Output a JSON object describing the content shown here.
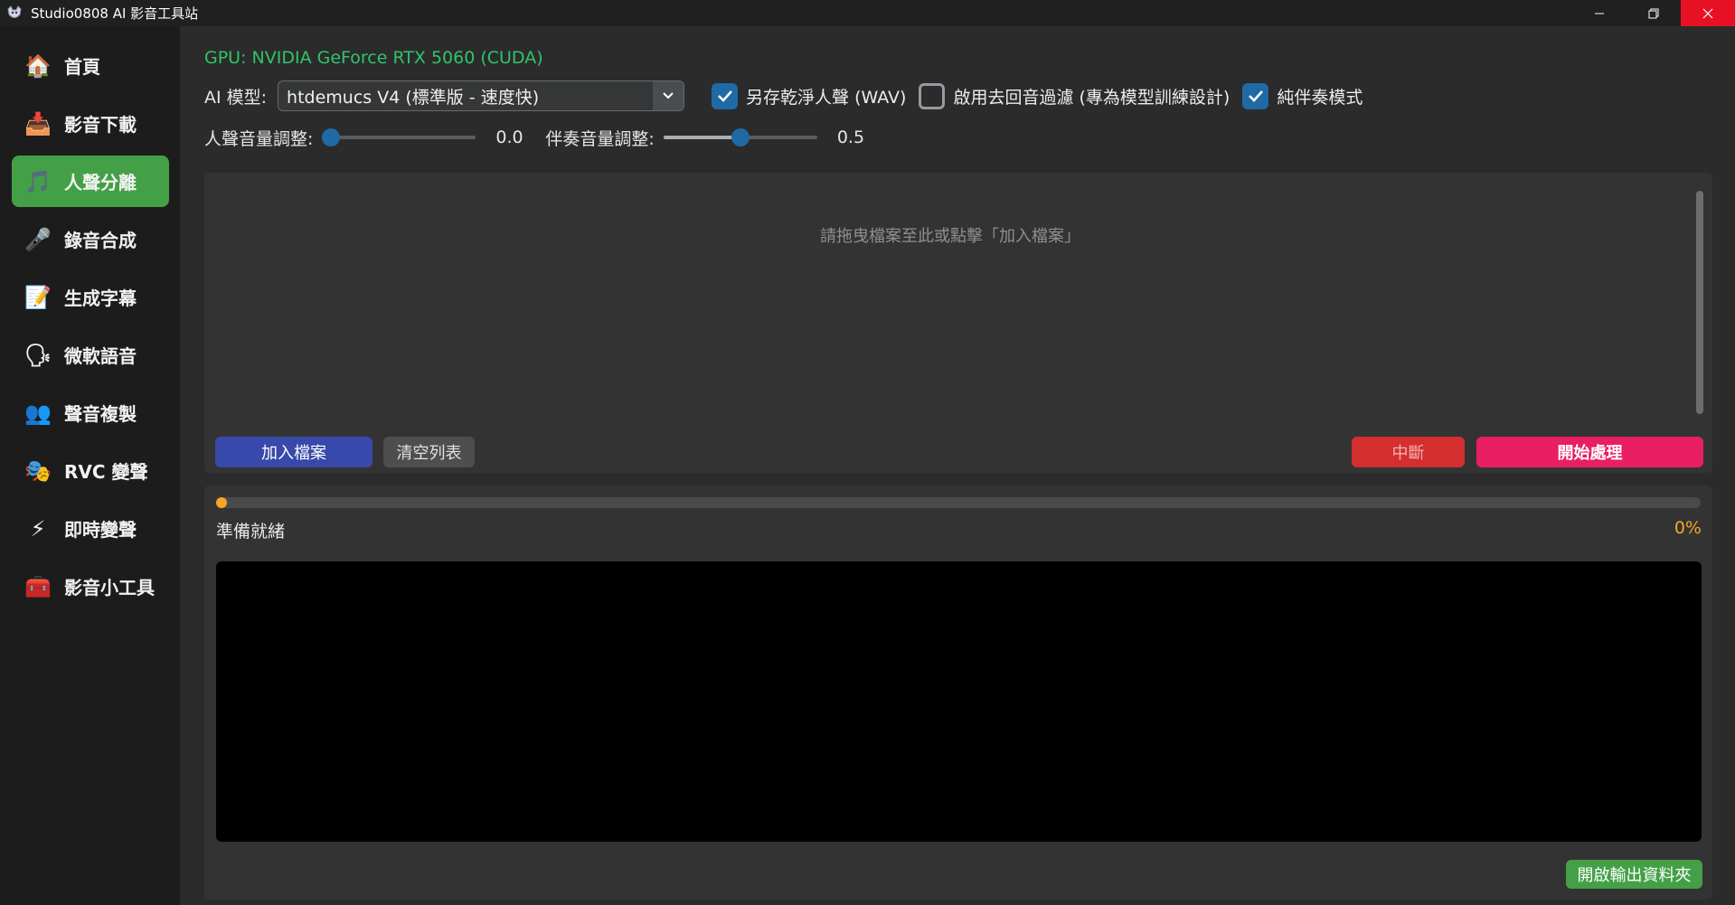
{
  "window": {
    "title": "Studio0808 AI 影音工具站",
    "controls": {
      "minimize": "—",
      "restore": "❐",
      "close": "✕"
    }
  },
  "sidebar": {
    "items": [
      {
        "label": "首頁",
        "icon": "home-icon",
        "glyph": "🏠",
        "active": false
      },
      {
        "label": "影音下載",
        "icon": "download-icon",
        "glyph": "📥",
        "active": false
      },
      {
        "label": "人聲分離",
        "icon": "music-note-icon",
        "glyph": "🎵",
        "active": true
      },
      {
        "label": "錄音合成",
        "icon": "microphone-icon",
        "glyph": "🎤",
        "active": false
      },
      {
        "label": "生成字幕",
        "icon": "memo-icon",
        "glyph": "📝",
        "active": false
      },
      {
        "label": "微軟語音",
        "icon": "speaking-head-icon",
        "glyph": "🗣",
        "active": false
      },
      {
        "label": "聲音複製",
        "icon": "people-icon",
        "glyph": "👥",
        "active": false
      },
      {
        "label": "RVC 變聲",
        "icon": "masks-icon",
        "glyph": "🎭",
        "active": false
      },
      {
        "label": "即時變聲",
        "icon": "lightning-icon",
        "glyph": "⚡",
        "active": false
      },
      {
        "label": "影音小工具",
        "icon": "toolbox-icon",
        "glyph": "🧰",
        "active": false
      }
    ],
    "accent": "#43a047"
  },
  "main": {
    "gpu": "GPU: NVIDIA GeForce RTX 5060 (CUDA)",
    "model_label": "AI 模型:",
    "model_value": "htdemucs V4 (標準版 - 速度快)",
    "options": [
      {
        "label": "另存乾淨人聲 (WAV)",
        "checked": true
      },
      {
        "label": "啟用去回音過濾 (專為模型訓練設計)",
        "checked": false
      },
      {
        "label": "純伴奏模式",
        "checked": true
      }
    ],
    "vocal_volume": {
      "label": "人聲音量調整:",
      "value": "0.0",
      "level": 0.0
    },
    "accomp_volume": {
      "label": "伴奏音量調整:",
      "value": "0.5",
      "level": 0.5
    },
    "drop_hint": "請拖曳檔案至此或點擊「加入檔案」",
    "buttons": {
      "add": "加入檔案",
      "clear": "清空列表",
      "stop": "中斷",
      "start": "開始處理",
      "open_output": "開啟輸出資料夾"
    },
    "progress": {
      "status": "準備就緒",
      "percent": "0%",
      "value": 0
    },
    "colors": {
      "gpu_text": "#2fc46a",
      "checkbox": "#1f6aa5",
      "progress": "#f5a623",
      "add_button": "#3949ab",
      "stop_button": "#d32f2f",
      "start_button": "#e91e63",
      "open_button": "#43a047"
    }
  }
}
